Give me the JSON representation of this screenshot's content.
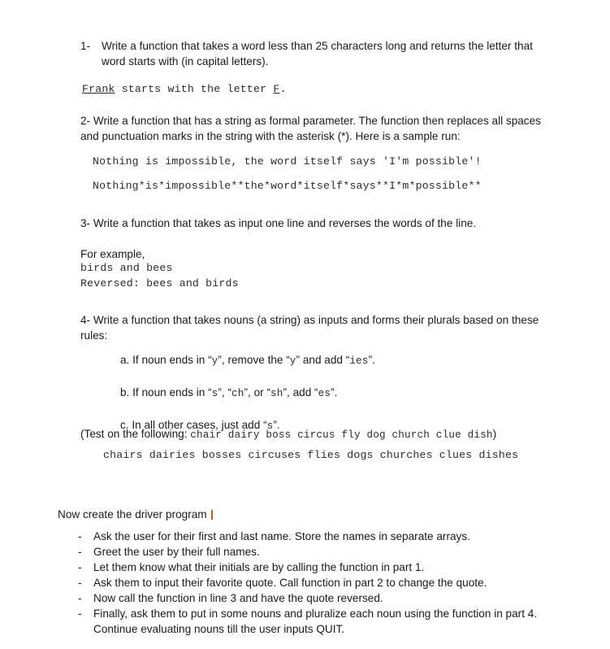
{
  "document": {
    "questions": [
      {
        "number": "1-",
        "text": "Write a function that takes a word less than 25 characters long and returns the letter that word starts with (in capital letters).",
        "sample": {
          "prefix_underlined": "Frank",
          "middle": " starts with the letter ",
          "suffix_underlined": "F",
          "end": "."
        }
      },
      {
        "number": "2-",
        "text": "Write a function that has a string as formal parameter. The function then replaces all spaces and punctuation marks in the string with the asterisk (*). Here is a sample run:",
        "sample_input": "Nothing is impossible, the word itself says 'I'm possible'!",
        "sample_output": "Nothing*is*impossible**the*word*itself*says**I*m*possible**"
      },
      {
        "number": "3-",
        "text": "Write a function that takes as input one line and reverses the words of the line.",
        "example_label": "For example,",
        "example_input": "birds and bees",
        "example_output": "Reversed: bees and birds"
      },
      {
        "number": "4-",
        "text": "Write a function that takes nouns (a string) as inputs and forms their plurals based on these rules:",
        "rules": [
          {
            "label": "a.",
            "part1": "If noun ends in “",
            "code1": "y",
            "part2": "”, remove the “",
            "code2": "y",
            "part3": "” and add “",
            "code3": "ies",
            "part4": "”."
          },
          {
            "label": "b.",
            "part1": "If noun ends in “",
            "code1": "s",
            "part2": "”, “",
            "code2": "ch",
            "part3": "”, or “",
            "code3": "sh",
            "part4": "”, add “",
            "code4": "es",
            "part5": "”."
          },
          {
            "label": "c.",
            "part1": "In all other cases, just add “",
            "code1": "s",
            "part2": "”."
          }
        ],
        "test_label": "(Test on the following:",
        "test_words": "chair dairy boss circus fly dog church clue dish",
        "test_close": ")",
        "expected_plurals": "chairs dairies bosses circuses flies dogs churches clues dishes"
      }
    ],
    "driver": {
      "heading": "Now create the driver program",
      "bullet_marker": "-",
      "items": [
        "Ask the user for their first and last name. Store the names in separate arrays.",
        "Greet the user by their full names.",
        "Let them know what their initials are by calling the function in part 1.",
        "Ask them to input their favorite quote. Call function in part 2 to change the quote.",
        "Now call the function in line 3 and have the quote reversed.",
        "Finally, ask them to put in some nouns and pluralize each noun using the function in part 4. Continue evaluating nouns till the user inputs QUIT."
      ]
    }
  }
}
